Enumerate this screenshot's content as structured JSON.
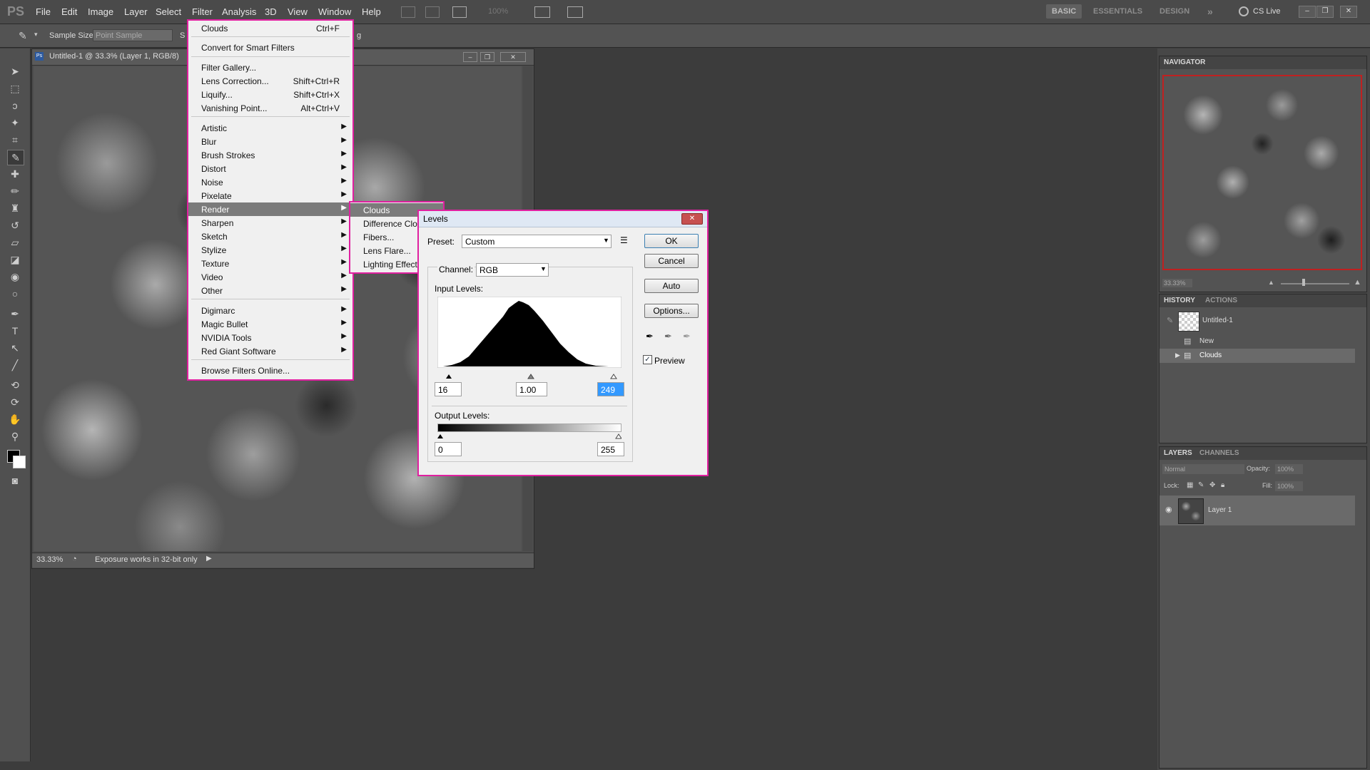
{
  "menubar": {
    "app_logo": "PS",
    "items": [
      "File",
      "Edit",
      "Image",
      "Layer",
      "Select",
      "Filter",
      "Analysis",
      "3D",
      "View",
      "Window",
      "Help"
    ],
    "zoom_value": "100%",
    "workspaces": {
      "basic": "BASIC",
      "essentials": "ESSENTIALS",
      "design": "DESIGN",
      "more": "»"
    },
    "cs_live": "CS Live"
  },
  "options_bar": {
    "sample_size_label": "Sample Size:",
    "sample_size_value": "Point Sample",
    "s_label": "S",
    "trailing_text": "g"
  },
  "document": {
    "title": "Untitled-1 @ 33.3% (Layer 1, RGB/8)",
    "zoom": "33.33%",
    "status_text": "Exposure works in 32-bit only"
  },
  "filter_menu": {
    "items": [
      {
        "label": "Clouds",
        "shortcut": "Ctrl+F"
      },
      {
        "label": "Convert for Smart Filters",
        "shortcut": ""
      },
      {
        "label": "Filter Gallery...",
        "shortcut": ""
      },
      {
        "label": "Lens Correction...",
        "shortcut": "Shift+Ctrl+R"
      },
      {
        "label": "Liquify...",
        "shortcut": "Shift+Ctrl+X"
      },
      {
        "label": "Vanishing Point...",
        "shortcut": "Alt+Ctrl+V"
      },
      {
        "label": "Artistic"
      },
      {
        "label": "Blur"
      },
      {
        "label": "Brush Strokes"
      },
      {
        "label": "Distort"
      },
      {
        "label": "Noise"
      },
      {
        "label": "Pixelate"
      },
      {
        "label": "Render"
      },
      {
        "label": "Sharpen"
      },
      {
        "label": "Sketch"
      },
      {
        "label": "Stylize"
      },
      {
        "label": "Texture"
      },
      {
        "label": "Video"
      },
      {
        "label": "Other"
      },
      {
        "label": "Digimarc"
      },
      {
        "label": "Magic Bullet"
      },
      {
        "label": "NVIDIA Tools"
      },
      {
        "label": "Red Giant Software"
      },
      {
        "label": "Browse Filters Online..."
      }
    ]
  },
  "render_submenu": {
    "items": [
      "Clouds",
      "Difference Clo",
      "Fibers...",
      "Lens Flare...",
      "Lighting Effect"
    ]
  },
  "levels_dialog": {
    "title": "Levels",
    "preset_label": "Preset:",
    "preset_value": "Custom",
    "channel_label": "Channel:",
    "channel_value": "RGB",
    "input_levels_label": "Input Levels:",
    "input_black": "16",
    "input_gamma": "1.00",
    "input_white": "249",
    "output_levels_label": "Output Levels:",
    "output_black": "0",
    "output_white": "255",
    "ok": "OK",
    "cancel": "Cancel",
    "auto": "Auto",
    "options": "Options...",
    "preview_label": "Preview",
    "preview_checked": true
  },
  "navigator": {
    "tab": "NAVIGATOR",
    "zoom": "33.33%"
  },
  "history": {
    "tabs": [
      "HISTORY",
      "ACTIONS"
    ],
    "snapshot": "Untitled-1",
    "steps": [
      "New",
      "Clouds"
    ]
  },
  "layers": {
    "tabs": [
      "LAYERS",
      "CHANNELS"
    ],
    "blend_mode": "Normal",
    "opacity_label": "Opacity:",
    "opacity_value": "100%",
    "lock_label": "Lock:",
    "fill_label": "Fill:",
    "fill_value": "100%",
    "layer_name": "Layer 1"
  },
  "colors": {
    "highlight_border": "#e020a0",
    "menu_highlight": "#7b7b7b"
  }
}
